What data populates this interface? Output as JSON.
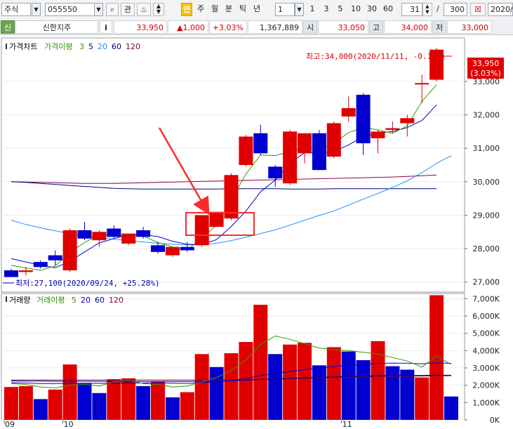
{
  "toolbar": {
    "market": "주식",
    "code": "055550",
    "gwan": "관",
    "yeon_label": "연",
    "periods": [
      "주",
      "월",
      "분",
      "틱",
      "년"
    ],
    "unit": "1",
    "multipliers": [
      "1",
      "3",
      "5",
      "10",
      "30",
      "60"
    ],
    "count_value": "31",
    "separator": "/",
    "total_value": "300",
    "date_value": "2020/"
  },
  "quote": {
    "badge": "신",
    "name": "신한지주",
    "info": "i",
    "price": "33,950",
    "change": "▲1,000",
    "change_pct": "+3.03%",
    "volume": "1,367,889",
    "open_label": "시",
    "open": "33,050",
    "high_label": "고",
    "high": "34,000",
    "low_label": "저",
    "low": "33,000"
  },
  "colors": {
    "up": "#e00000",
    "down": "#0000d0",
    "ma3": "#339900",
    "ma5": "#0000cc",
    "ma20": "#1e90ff",
    "ma60": "#000080",
    "ma120": "#8b0045",
    "annotation": "#ff2a2a"
  },
  "chart_data": [
    {
      "type": "candlestick",
      "legend": [
        {
          "text": "가격차트",
          "color": "#000000"
        },
        {
          "text": "가격이평",
          "color": "#339900"
        },
        {
          "text": "3",
          "color": "#339900"
        },
        {
          "text": "5",
          "color": "#0000cc"
        },
        {
          "text": "20",
          "color": "#1e90ff"
        },
        {
          "text": "60",
          "color": "#000080"
        },
        {
          "text": "120",
          "color": "#8b0045"
        }
      ],
      "ylim": [
        26700,
        34300
      ],
      "yticks": [
        27000,
        28000,
        29000,
        30000,
        31000,
        32000,
        33000
      ],
      "ytick_labels": [
        "27,000",
        "28,000",
        "29,000",
        "30,000",
        "31,000",
        "32,000",
        "33,000"
      ],
      "x_labels": [
        {
          "index": 0,
          "text": "09"
        },
        {
          "index": 4,
          "text": "10"
        },
        {
          "index": 23,
          "text": "11"
        }
      ],
      "candles": [
        {
          "o": 27350,
          "h": 27400,
          "l": 27150,
          "c": 27150
        },
        {
          "o": 27300,
          "h": 27450,
          "l": 27200,
          "c": 27350
        },
        {
          "o": 27600,
          "h": 27650,
          "l": 27400,
          "c": 27450
        },
        {
          "o": 27800,
          "h": 27950,
          "l": 27500,
          "c": 27650
        },
        {
          "o": 27350,
          "h": 28600,
          "l": 27300,
          "c": 28550
        },
        {
          "o": 28550,
          "h": 28800,
          "l": 28250,
          "c": 28300
        },
        {
          "o": 28250,
          "h": 28550,
          "l": 28050,
          "c": 28500
        },
        {
          "o": 28600,
          "h": 28700,
          "l": 28300,
          "c": 28350
        },
        {
          "o": 28150,
          "h": 28450,
          "l": 28100,
          "c": 28450
        },
        {
          "o": 28550,
          "h": 28650,
          "l": 28300,
          "c": 28350
        },
        {
          "o": 28100,
          "h": 28200,
          "l": 27850,
          "c": 27900
        },
        {
          "o": 27800,
          "h": 28050,
          "l": 27750,
          "c": 28050
        },
        {
          "o": 28050,
          "h": 28200,
          "l": 27900,
          "c": 27950
        },
        {
          "o": 28100,
          "h": 29000,
          "l": 28050,
          "c": 29000
        },
        {
          "o": 28650,
          "h": 29100,
          "l": 28650,
          "c": 29100
        },
        {
          "o": 28900,
          "h": 30250,
          "l": 28850,
          "c": 30200
        },
        {
          "o": 30500,
          "h": 31400,
          "l": 30450,
          "c": 31350
        },
        {
          "o": 31450,
          "h": 31700,
          "l": 30800,
          "c": 30850
        },
        {
          "o": 30450,
          "h": 30500,
          "l": 29850,
          "c": 30100
        },
        {
          "o": 29950,
          "h": 31550,
          "l": 29900,
          "c": 31500
        },
        {
          "o": 30850,
          "h": 31450,
          "l": 30550,
          "c": 31450
        },
        {
          "o": 31450,
          "h": 31550,
          "l": 30350,
          "c": 30350
        },
        {
          "o": 30750,
          "h": 31800,
          "l": 30700,
          "c": 31750
        },
        {
          "o": 31950,
          "h": 32550,
          "l": 31800,
          "c": 32200
        },
        {
          "o": 32600,
          "h": 32650,
          "l": 30800,
          "c": 31150
        },
        {
          "o": 31300,
          "h": 31550,
          "l": 30850,
          "c": 31500
        },
        {
          "o": 31550,
          "h": 31800,
          "l": 31450,
          "c": 31600
        },
        {
          "o": 31750,
          "h": 32000,
          "l": 31350,
          "c": 31900
        },
        {
          "o": 32950,
          "h": 33200,
          "l": 32350,
          "c": 32950
        },
        {
          "o": 33050,
          "h": 34000,
          "l": 33000,
          "c": 33950
        }
      ],
      "ma3": [
        27500,
        27420,
        27350,
        27480,
        27880,
        28180,
        28420,
        28390,
        28400,
        28380,
        28180,
        28050,
        27960,
        28320,
        28700,
        29450,
        30230,
        30800,
        30780,
        30900,
        31000,
        30980,
        31150,
        31470,
        31620,
        31550,
        31450,
        31670,
        32400,
        32900
      ],
      "ma5": [
        27700,
        27600,
        27500,
        27430,
        27620,
        27900,
        28170,
        28300,
        28420,
        28420,
        28360,
        28220,
        28130,
        28120,
        28270,
        28660,
        29120,
        29700,
        30050,
        30550,
        30870,
        30860,
        30900,
        31100,
        31350,
        31460,
        31500,
        31620,
        31830,
        32300
      ],
      "ma20": [
        28850,
        28720,
        28620,
        28530,
        28450,
        28380,
        28330,
        28280,
        28240,
        28200,
        28160,
        28130,
        28110,
        28120,
        28160,
        28240,
        28340,
        28450,
        28560,
        28700,
        28850,
        28990,
        29130,
        29300,
        29480,
        29650,
        29830,
        30030,
        30270,
        30550,
        30780
      ],
      "ma60": [
        30000,
        29980,
        29950,
        29920,
        29890,
        29860,
        29830,
        29800,
        29790,
        29780,
        29780,
        29780,
        29780,
        29780,
        29780,
        29790,
        29790,
        29790,
        29790,
        29780,
        29780,
        29780,
        29790,
        29790,
        29790,
        29790,
        29790,
        29790,
        29790,
        29790
      ],
      "ma120": [
        30000,
        29990,
        29980,
        29970,
        29960,
        29950,
        29950,
        29950,
        29960,
        29970,
        29980,
        29990,
        30000,
        30010,
        30020,
        30030,
        30040,
        30050,
        30060,
        30070,
        30080,
        30090,
        30100,
        30110,
        30120,
        30130,
        30140,
        30160,
        30180,
        30200
      ],
      "annotations": {
        "high_label": "최고:34,000(2020/11/11, -0.15%)",
        "low_label": "최저:27,100(2020/09/24, +25.28%)",
        "price_tag": "33,950",
        "pct_tag": "(3.03%)"
      }
    },
    {
      "type": "bar",
      "legend": [
        {
          "text": "거래량",
          "color": "#000000"
        },
        {
          "text": "거래이평",
          "color": "#339900"
        },
        {
          "text": "5",
          "color": "#339900"
        },
        {
          "text": "20",
          "color": "#0000cc"
        },
        {
          "text": "60",
          "color": "#000080"
        },
        {
          "text": "120",
          "color": "#8b0045"
        }
      ],
      "ylim": [
        0,
        7300
      ],
      "yticks": [
        0,
        1000,
        2000,
        3000,
        4000,
        5000,
        6000,
        7000
      ],
      "ytick_labels": [
        "0K",
        "1,000K",
        "2,000K",
        "3,000K",
        "4,000K",
        "5,000K",
        "6,000K",
        "7,000K"
      ],
      "values": [
        1900,
        1950,
        1200,
        1750,
        3200,
        2100,
        1550,
        2350,
        2400,
        1950,
        2200,
        1300,
        1600,
        3800,
        3050,
        3850,
        4500,
        6650,
        3800,
        4350,
        4450,
        3150,
        4200,
        3950,
        3450,
        4550,
        3100,
        2900,
        2450,
        7200,
        1350
      ],
      "colors": [
        "up",
        "up",
        "down",
        "up",
        "up",
        "down",
        "down",
        "up",
        "up",
        "down",
        "up",
        "down",
        "up",
        "up",
        "down",
        "up",
        "up",
        "up",
        "down",
        "up",
        "up",
        "down",
        "up",
        "down",
        "down",
        "up",
        "down",
        "down",
        "up",
        "up",
        "down"
      ],
      "ma5": [
        2100,
        2050,
        1900,
        1850,
        2000,
        2050,
        1950,
        2200,
        2300,
        2100,
        2050,
        1900,
        1950,
        2200,
        2450,
        2850,
        3450,
        4350,
        4850,
        4650,
        4400,
        4150,
        4050,
        4000,
        3900,
        3800,
        3600,
        3400,
        3050,
        3700,
        3200
      ],
      "ma20": [
        2150,
        2130,
        2100,
        2100,
        2110,
        2120,
        2110,
        2120,
        2130,
        2130,
        2140,
        2120,
        2110,
        2150,
        2200,
        2270,
        2380,
        2560,
        2680,
        2790,
        2900,
        2990,
        3080,
        3150,
        3200,
        3260,
        3280,
        3270,
        3240,
        3300,
        3260
      ],
      "ma60": [
        2250,
        2240,
        2240,
        2230,
        2230,
        2230,
        2230,
        2220,
        2220,
        2220,
        2220,
        2220,
        2220,
        2230,
        2240,
        2260,
        2290,
        2330,
        2360,
        2390,
        2420,
        2450,
        2480,
        2510,
        2530,
        2550,
        2560,
        2570,
        2570,
        2580,
        2580
      ],
      "ma120": [
        2300,
        2300,
        2300,
        2300,
        2300,
        2300,
        2300,
        2300,
        2300,
        2300,
        2300,
        2300,
        2300,
        2300,
        2310,
        2320,
        2330,
        2340,
        2360,
        2380,
        2400,
        2420,
        2440,
        2460,
        2480,
        2500,
        2510,
        2520,
        2530,
        2540,
        2550
      ]
    }
  ]
}
